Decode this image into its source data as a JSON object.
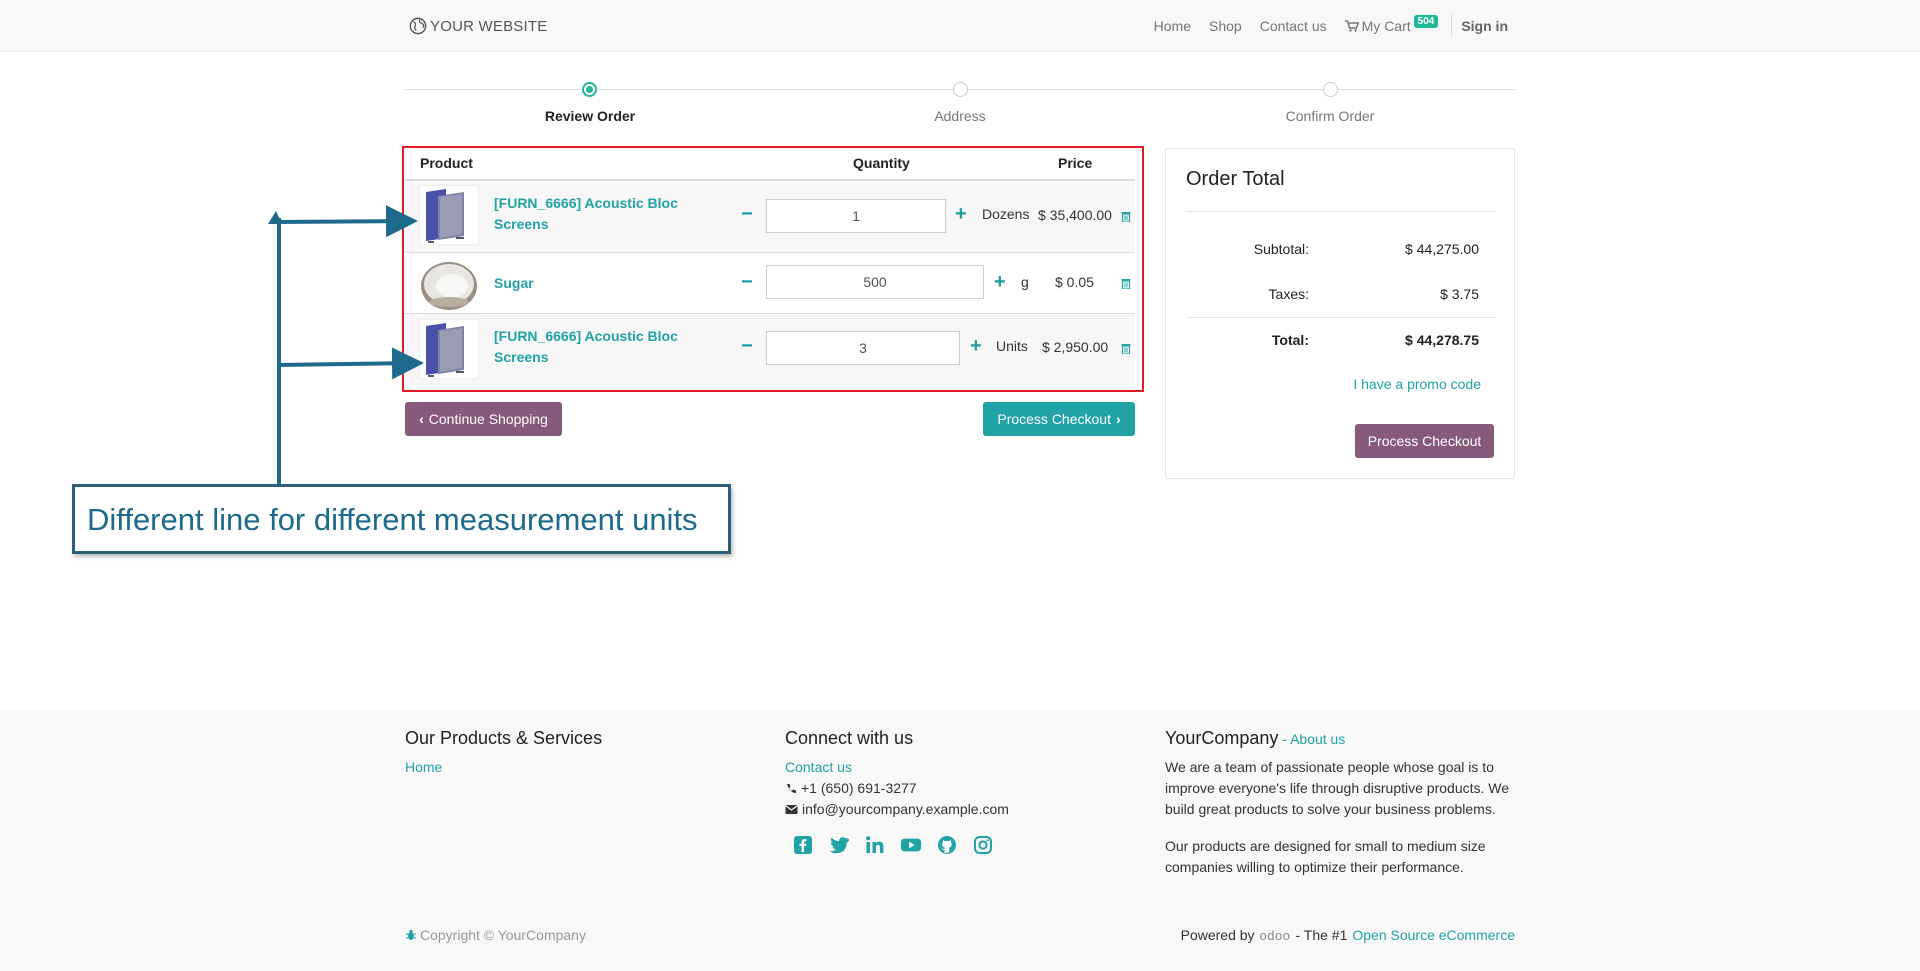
{
  "header": {
    "logo_text": "YOUR WEBSITE",
    "nav": [
      "Home",
      "Shop",
      "Contact us"
    ],
    "cart_label": "My Cart",
    "cart_count": "504",
    "sign_in": "Sign in"
  },
  "progress": {
    "steps": [
      "Review Order",
      "Address",
      "Confirm Order"
    ],
    "active_step": "Review Order"
  },
  "cart": {
    "headers": {
      "product": "Product",
      "quantity": "Quantity",
      "price": "Price"
    },
    "rows": [
      {
        "name": "[FURN_6666] Acoustic Bloc Screens",
        "quantity": "1",
        "uom": "Dozens",
        "price": "$ 35,400.00",
        "image": "acoustic-screen"
      },
      {
        "name": "Sugar",
        "quantity": "500",
        "uom": "g",
        "price": "$ 0.05",
        "image": "sugar-bowl"
      },
      {
        "name": "[FURN_6666] Acoustic Bloc Screens",
        "quantity": "3",
        "uom": "Units",
        "price": "$ 2,950.00",
        "image": "acoustic-screen"
      }
    ],
    "continue_label": "Continue Shopping",
    "checkout_label": "Process Checkout"
  },
  "order_total": {
    "title": "Order Total",
    "subtotal_label": "Subtotal:",
    "subtotal": "$ 44,275.00",
    "taxes_label": "Taxes:",
    "taxes": "$ 3.75",
    "total_label": "Total:",
    "total": "$ 44,278.75",
    "promo": "I have a promo code",
    "checkout_label": "Process Checkout"
  },
  "annotation": {
    "text": "Different line for different measurement units"
  },
  "footer": {
    "col1_title": "Our Products & Services",
    "col1_link": "Home",
    "col2_title": "Connect with us",
    "contact_link": "Contact us",
    "phone": "+1 (650) 691-3277",
    "email": "info@yourcompany.example.com",
    "social": [
      "facebook-icon",
      "twitter-icon",
      "linkedin-icon",
      "youtube-icon",
      "github-icon",
      "instagram-icon"
    ],
    "col3_title": "YourCompany",
    "about_sep": " - ",
    "about_link": "About us",
    "about_text_1": "We are a team of passionate people whose goal is to improve everyone's life through disruptive products. We build great products to solve your business problems.",
    "about_text_2": "Our products are designed for small to medium size companies willing to optimize their performance.",
    "copyright": "Copyright © YourCompany",
    "powered_by": "Powered by",
    "odoo_logo_text": "odoo",
    "powered_mid": "- The #1",
    "powered_link": "Open Source eCommerce"
  },
  "colors": {
    "accent_teal": "#21a2a5",
    "brand_purple": "#875a7b",
    "highlight_red": "#e01b24",
    "annotation_blue": "#1d6a8c"
  }
}
